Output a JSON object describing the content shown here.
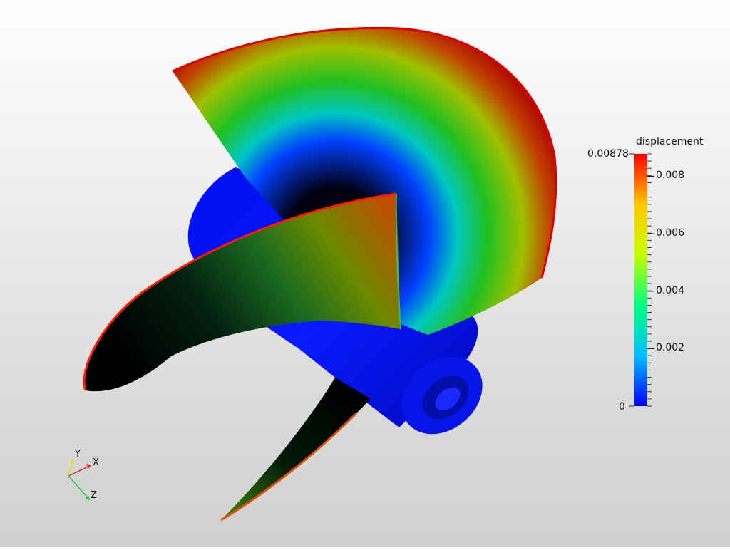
{
  "colorbar": {
    "title": "displacement",
    "max_label": "0.00878",
    "min_label": "0",
    "ticks": [
      {
        "label": "0.008",
        "value": 0.008
      },
      {
        "label": "0.006",
        "value": 0.006
      },
      {
        "label": "0.004",
        "value": 0.004
      },
      {
        "label": "0.002",
        "value": 0.002
      }
    ],
    "range": [
      0,
      0.00878
    ],
    "colormap": [
      "#0000ff",
      "#00bfff",
      "#00ff80",
      "#c8ff00",
      "#ffc800",
      "#ff0000"
    ]
  },
  "axes_widget": {
    "x_label": "X",
    "y_label": "Y",
    "z_label": "Z",
    "x_color": "#dd2222",
    "y_color": "#dddd22",
    "z_color": "#22cc44"
  },
  "scene": {
    "background_top": "#fefefe",
    "background_bottom": "#d0d0d0",
    "hub_color": "#0a1aff"
  }
}
